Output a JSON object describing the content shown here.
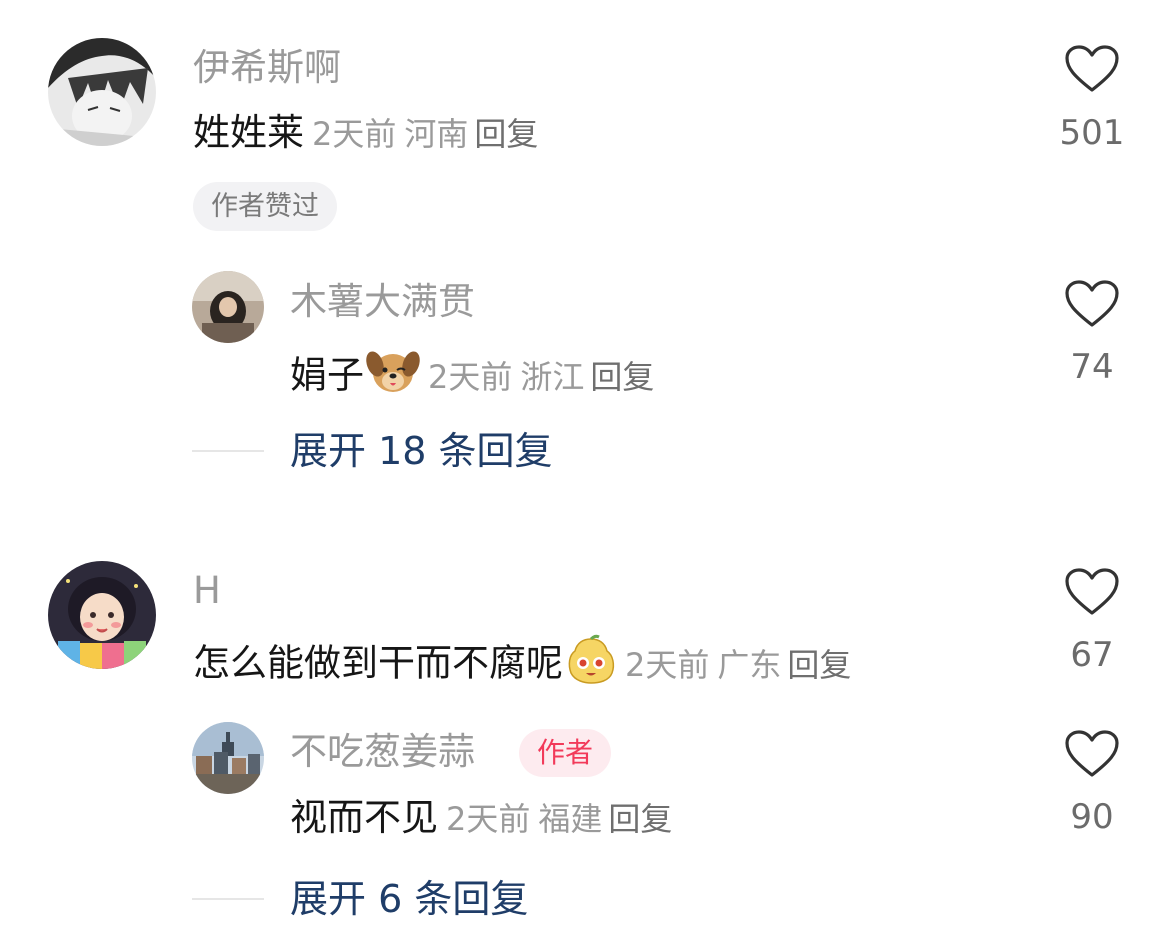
{
  "comments": [
    {
      "username": "伊希斯啊",
      "text": "姓姓莱",
      "time": "2天前",
      "location": "河南",
      "reply_label": "回复",
      "likes": "501",
      "badge": "作者赞过",
      "replies": [
        {
          "username": "木薯大满贯",
          "text": "娟子",
          "emoji": "dog-face-emoji",
          "time": "2天前",
          "location": "浙江",
          "reply_label": "回复",
          "likes": "74"
        }
      ],
      "expand_label": "展开 18 条回复"
    },
    {
      "username": "H",
      "text": "怎么能做到干而不腐呢",
      "emoji": "yellow-blob-emoji",
      "time": "2天前",
      "location": "广东",
      "reply_label": "回复",
      "likes": "67",
      "replies": [
        {
          "username": "不吃葱姜蒜",
          "author_badge": "作者",
          "text": "视而不见",
          "time": "2天前",
          "location": "福建",
          "reply_label": "回复",
          "likes": "90"
        }
      ],
      "expand_label": "展开 6 条回复"
    }
  ],
  "colors": {
    "accent_link": "#1f3d68",
    "author_badge": "#f23a5a",
    "muted_text": "#9a9a9a"
  },
  "icons": {
    "like": "heart-outline-icon"
  }
}
